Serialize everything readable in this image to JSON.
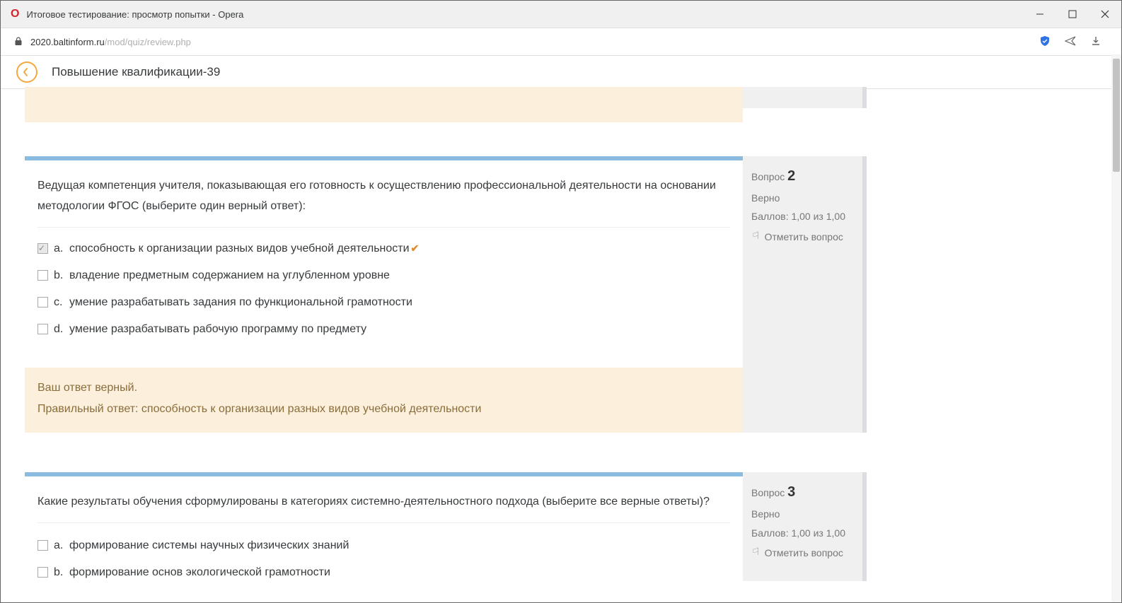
{
  "window": {
    "title": "Итоговое тестирование: просмотр попытки - Opera"
  },
  "addressbar": {
    "host": "2020.baltinform.ru",
    "path": "/mod/quiz/review.php"
  },
  "site": {
    "title": "Повышение квалификации-39"
  },
  "side_labels": {
    "question_word": "Вопрос",
    "flag": "Отметить вопрос"
  },
  "q2": {
    "number": "2",
    "status": "Верно",
    "grade": "Баллов: 1,00 из 1,00",
    "text": "Ведущая компетенция учителя, показывающая его готовность к осуществлению профессиональной деятельности на основании методологии ФГОС (выберите один верный ответ):",
    "answers": {
      "a": "способность к организации разных видов учебной деятельности",
      "b": "владение предметным содержанием на углубленном уровне",
      "c": "умение разрабатывать задания по функциональной грамотности",
      "d": "умение разрабатывать рабочую программу по предмету"
    },
    "feedback_line1": "Ваш ответ верный.",
    "feedback_line2": "Правильный ответ: способность к организации разных видов учебной деятельности"
  },
  "q3": {
    "number": "3",
    "status": "Верно",
    "grade": "Баллов: 1,00 из 1,00",
    "text": "Какие результаты обучения сформулированы в категориях системно-деятельностного подхода (выберите все верные ответы)?",
    "answers": {
      "a": "формирование системы научных физических знаний",
      "b": "формирование основ экологической грамотности"
    }
  }
}
